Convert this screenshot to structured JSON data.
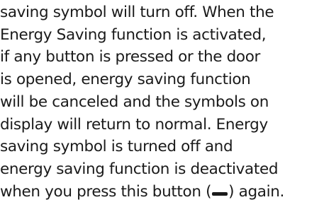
{
  "paragraph": {
    "lines": [
      "saving symbol will turn off. When the",
      "Energy Saving function is activated,",
      "if any button is pressed or the door",
      "is opened, energy saving function",
      "will be canceled and the symbols on",
      "display will return to normal. Energy",
      "saving symbol is turned off and",
      "energy saving function is deactivated"
    ],
    "last_line_before": "when you press this button (",
    "last_line_after": ") again.",
    "inline_icon": "minus-bar-icon"
  }
}
